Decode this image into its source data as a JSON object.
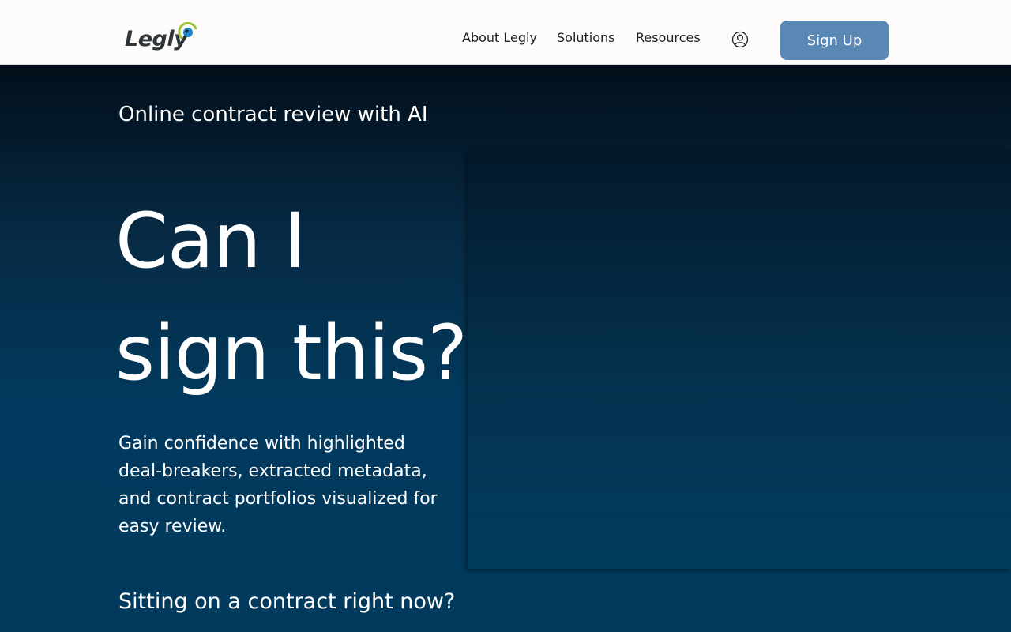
{
  "header": {
    "logo_text": "Legly",
    "nav": [
      {
        "label": "About Legly"
      },
      {
        "label": "Solutions"
      },
      {
        "label": "Resources"
      }
    ],
    "account_icon": "user-circle-icon",
    "signup_label": "Sign Up"
  },
  "hero": {
    "eyebrow": "Online contract review with AI",
    "headline_line1": "Can I",
    "headline_line2": "sign this?",
    "description": "Gain confidence with highlighted deal-breakers, extracted metadata, and contract portfolios visualized for easy review.",
    "cta_question": "Sitting on a contract right now?"
  },
  "colors": {
    "header_bg": "#fdfcfa",
    "hero_bg": "#013a5c",
    "button_bg": "#5a88b5",
    "logo_accent_green": "#9cc43a",
    "logo_accent_blue": "#1e88c8"
  }
}
